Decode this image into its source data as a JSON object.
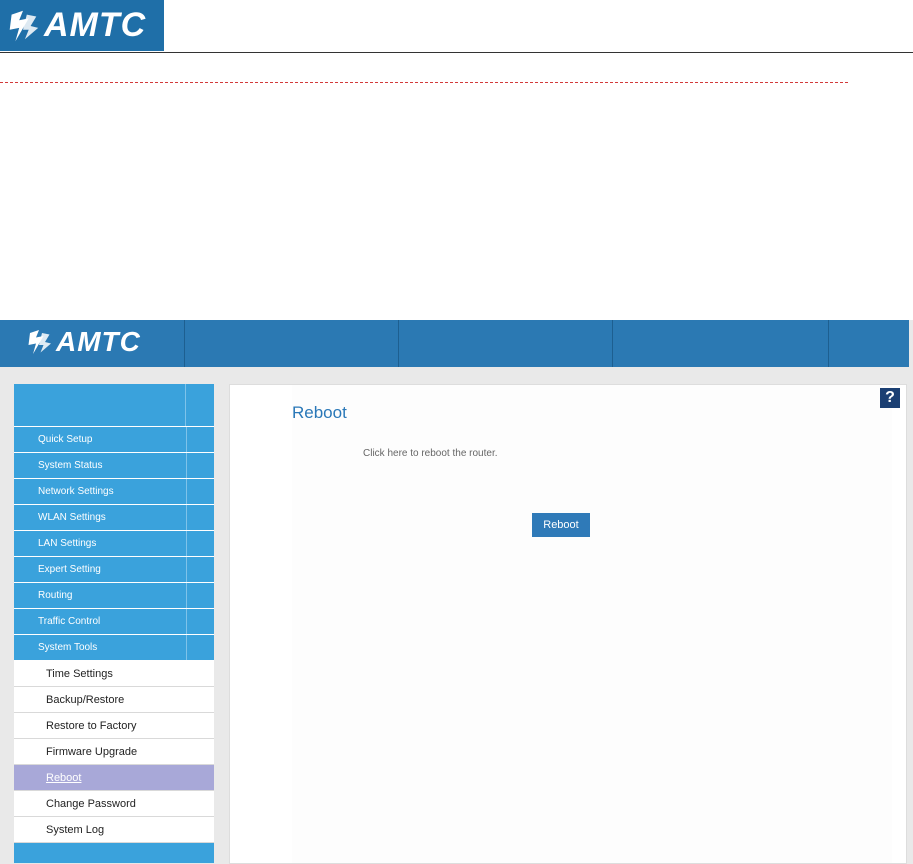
{
  "document": {
    "logo_text": "AMTC"
  },
  "router": {
    "logo_text": "AMTC",
    "sidebar": {
      "items": [
        {
          "label": "Quick Setup"
        },
        {
          "label": "System Status"
        },
        {
          "label": "Network Settings"
        },
        {
          "label": "WLAN Settings"
        },
        {
          "label": "LAN Settings"
        },
        {
          "label": "Expert Setting"
        },
        {
          "label": "Routing"
        },
        {
          "label": "Traffic Control"
        },
        {
          "label": "System Tools"
        }
      ],
      "subitems": [
        {
          "label": "Time Settings"
        },
        {
          "label": "Backup/Restore"
        },
        {
          "label": "Restore to Factory"
        },
        {
          "label": "Firmware Upgrade"
        },
        {
          "label": "Reboot",
          "active": true
        },
        {
          "label": "Change Password"
        },
        {
          "label": "System Log"
        }
      ]
    },
    "content": {
      "title": "Reboot",
      "description": "Click here to reboot the router.",
      "button_label": "Reboot",
      "help_label": "?"
    }
  },
  "colors": {
    "brand": "#2b79b3",
    "sidebar": "#3aa2dc",
    "active_item": "#a8a8d8",
    "title": "#2a78b8"
  },
  "icons": {
    "logo": "amtc-logo-icon",
    "help": "help-icon"
  }
}
